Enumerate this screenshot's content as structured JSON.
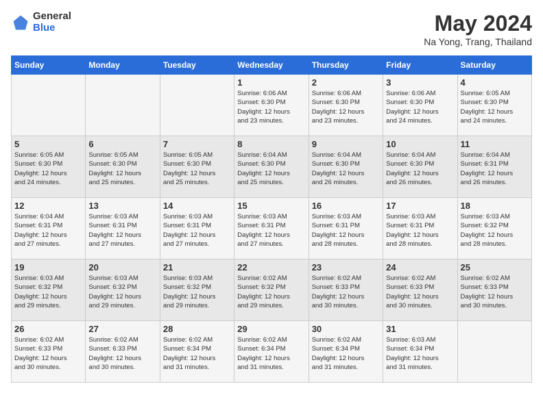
{
  "header": {
    "logo_general": "General",
    "logo_blue": "Blue",
    "title": "May 2024",
    "subtitle": "Na Yong, Trang, Thailand"
  },
  "calendar": {
    "weekdays": [
      "Sunday",
      "Monday",
      "Tuesday",
      "Wednesday",
      "Thursday",
      "Friday",
      "Saturday"
    ],
    "weeks": [
      [
        {
          "day": "",
          "detail": ""
        },
        {
          "day": "",
          "detail": ""
        },
        {
          "day": "",
          "detail": ""
        },
        {
          "day": "1",
          "detail": "Sunrise: 6:06 AM\nSunset: 6:30 PM\nDaylight: 12 hours\nand 23 minutes."
        },
        {
          "day": "2",
          "detail": "Sunrise: 6:06 AM\nSunset: 6:30 PM\nDaylight: 12 hours\nand 23 minutes."
        },
        {
          "day": "3",
          "detail": "Sunrise: 6:06 AM\nSunset: 6:30 PM\nDaylight: 12 hours\nand 24 minutes."
        },
        {
          "day": "4",
          "detail": "Sunrise: 6:05 AM\nSunset: 6:30 PM\nDaylight: 12 hours\nand 24 minutes."
        }
      ],
      [
        {
          "day": "5",
          "detail": "Sunrise: 6:05 AM\nSunset: 6:30 PM\nDaylight: 12 hours\nand 24 minutes."
        },
        {
          "day": "6",
          "detail": "Sunrise: 6:05 AM\nSunset: 6:30 PM\nDaylight: 12 hours\nand 25 minutes."
        },
        {
          "day": "7",
          "detail": "Sunrise: 6:05 AM\nSunset: 6:30 PM\nDaylight: 12 hours\nand 25 minutes."
        },
        {
          "day": "8",
          "detail": "Sunrise: 6:04 AM\nSunset: 6:30 PM\nDaylight: 12 hours\nand 25 minutes."
        },
        {
          "day": "9",
          "detail": "Sunrise: 6:04 AM\nSunset: 6:30 PM\nDaylight: 12 hours\nand 26 minutes."
        },
        {
          "day": "10",
          "detail": "Sunrise: 6:04 AM\nSunset: 6:30 PM\nDaylight: 12 hours\nand 26 minutes."
        },
        {
          "day": "11",
          "detail": "Sunrise: 6:04 AM\nSunset: 6:31 PM\nDaylight: 12 hours\nand 26 minutes."
        }
      ],
      [
        {
          "day": "12",
          "detail": "Sunrise: 6:04 AM\nSunset: 6:31 PM\nDaylight: 12 hours\nand 27 minutes."
        },
        {
          "day": "13",
          "detail": "Sunrise: 6:03 AM\nSunset: 6:31 PM\nDaylight: 12 hours\nand 27 minutes."
        },
        {
          "day": "14",
          "detail": "Sunrise: 6:03 AM\nSunset: 6:31 PM\nDaylight: 12 hours\nand 27 minutes."
        },
        {
          "day": "15",
          "detail": "Sunrise: 6:03 AM\nSunset: 6:31 PM\nDaylight: 12 hours\nand 27 minutes."
        },
        {
          "day": "16",
          "detail": "Sunrise: 6:03 AM\nSunset: 6:31 PM\nDaylight: 12 hours\nand 28 minutes."
        },
        {
          "day": "17",
          "detail": "Sunrise: 6:03 AM\nSunset: 6:31 PM\nDaylight: 12 hours\nand 28 minutes."
        },
        {
          "day": "18",
          "detail": "Sunrise: 6:03 AM\nSunset: 6:32 PM\nDaylight: 12 hours\nand 28 minutes."
        }
      ],
      [
        {
          "day": "19",
          "detail": "Sunrise: 6:03 AM\nSunset: 6:32 PM\nDaylight: 12 hours\nand 29 minutes."
        },
        {
          "day": "20",
          "detail": "Sunrise: 6:03 AM\nSunset: 6:32 PM\nDaylight: 12 hours\nand 29 minutes."
        },
        {
          "day": "21",
          "detail": "Sunrise: 6:03 AM\nSunset: 6:32 PM\nDaylight: 12 hours\nand 29 minutes."
        },
        {
          "day": "22",
          "detail": "Sunrise: 6:02 AM\nSunset: 6:32 PM\nDaylight: 12 hours\nand 29 minutes."
        },
        {
          "day": "23",
          "detail": "Sunrise: 6:02 AM\nSunset: 6:33 PM\nDaylight: 12 hours\nand 30 minutes."
        },
        {
          "day": "24",
          "detail": "Sunrise: 6:02 AM\nSunset: 6:33 PM\nDaylight: 12 hours\nand 30 minutes."
        },
        {
          "day": "25",
          "detail": "Sunrise: 6:02 AM\nSunset: 6:33 PM\nDaylight: 12 hours\nand 30 minutes."
        }
      ],
      [
        {
          "day": "26",
          "detail": "Sunrise: 6:02 AM\nSunset: 6:33 PM\nDaylight: 12 hours\nand 30 minutes."
        },
        {
          "day": "27",
          "detail": "Sunrise: 6:02 AM\nSunset: 6:33 PM\nDaylight: 12 hours\nand 30 minutes."
        },
        {
          "day": "28",
          "detail": "Sunrise: 6:02 AM\nSunset: 6:34 PM\nDaylight: 12 hours\nand 31 minutes."
        },
        {
          "day": "29",
          "detail": "Sunrise: 6:02 AM\nSunset: 6:34 PM\nDaylight: 12 hours\nand 31 minutes."
        },
        {
          "day": "30",
          "detail": "Sunrise: 6:02 AM\nSunset: 6:34 PM\nDaylight: 12 hours\nand 31 minutes."
        },
        {
          "day": "31",
          "detail": "Sunrise: 6:03 AM\nSunset: 6:34 PM\nDaylight: 12 hours\nand 31 minutes."
        },
        {
          "day": "",
          "detail": ""
        }
      ]
    ]
  }
}
